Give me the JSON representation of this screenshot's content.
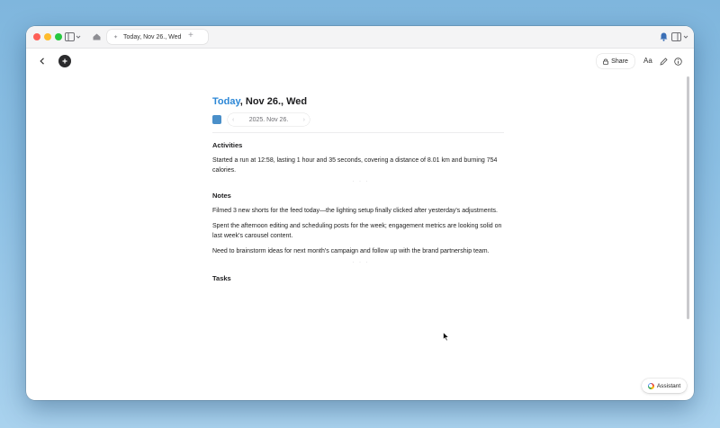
{
  "browser": {
    "tab_title": "Today, Nov 26., Wed",
    "new_tab_icon": "plus-icon"
  },
  "toolbar": {
    "share_label": "Share",
    "font_label": "Aa"
  },
  "page": {
    "title_today": "Today",
    "title_rest": ", Nov 26., Wed",
    "date_value": "2025. Nov 26.",
    "accent_color": "#2c87d6"
  },
  "sections": {
    "activities": {
      "heading": "Activities",
      "items": [
        "Started a run at 12:58, lasting 1 hour and 35 seconds, covering a distance of 8.01 km and burning 754 calories."
      ]
    },
    "notes": {
      "heading": "Notes",
      "items": [
        "Filmed 3 new shorts for the feed today—the lighting setup finally clicked after yesterday's adjustments.",
        "Spent the afternoon editing and scheduling posts for the week; engagement metrics are looking solid on last week's carousel content.",
        "Need to brainstorm ideas for next month's campaign and follow up with the brand partnership team."
      ]
    },
    "tasks": {
      "heading": "Tasks"
    }
  },
  "separator": "· · ·",
  "assistant": {
    "label": "Assistant"
  }
}
